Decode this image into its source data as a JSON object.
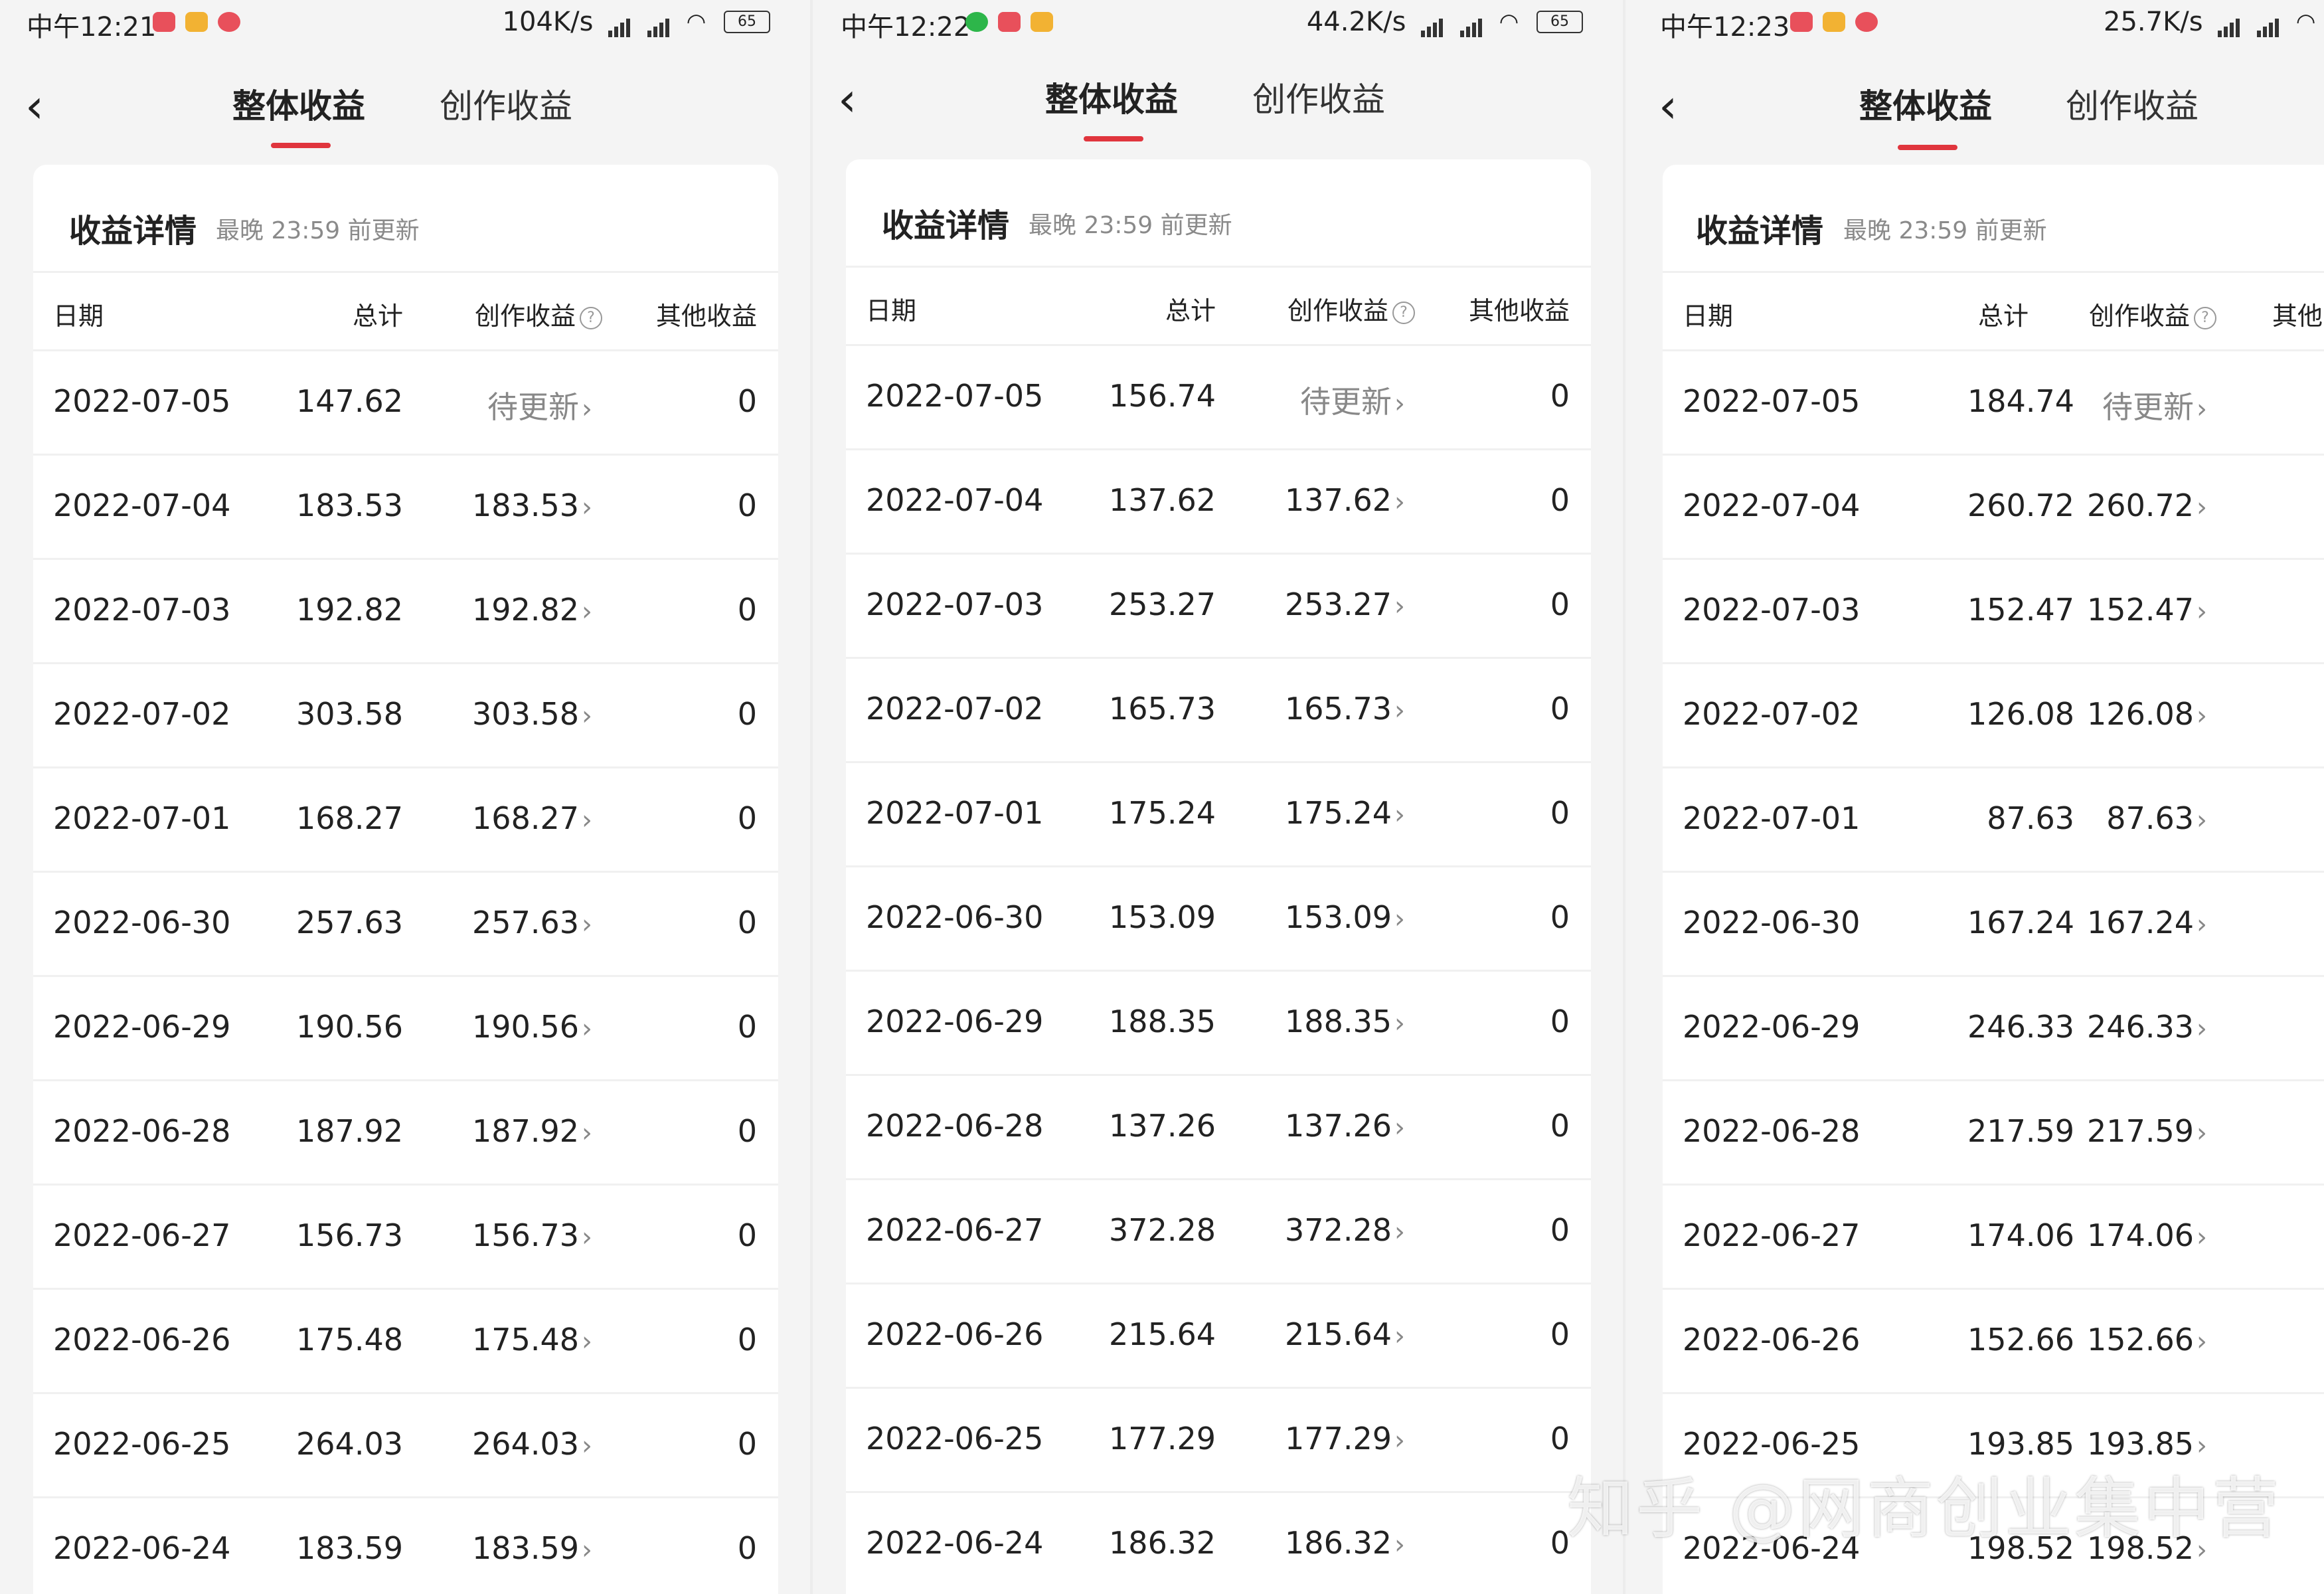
{
  "screens": [
    {
      "status": {
        "time": "中午12:21",
        "net": "104K/s",
        "battery": "65"
      },
      "tabs": [
        "整体收益",
        "创作收益"
      ],
      "card": {
        "title": "收益详情",
        "subtitle": "最晚 23:59 前更新"
      },
      "headers": {
        "date": "日期",
        "total": "总计",
        "creation": "创作收益",
        "other": "其他收益"
      },
      "rows": [
        {
          "date": "2022-07-05",
          "total": "147.62",
          "creation": "待更新",
          "other": "0"
        },
        {
          "date": "2022-07-04",
          "total": "183.53",
          "creation": "183.53",
          "other": "0"
        },
        {
          "date": "2022-07-03",
          "total": "192.82",
          "creation": "192.82",
          "other": "0"
        },
        {
          "date": "2022-07-02",
          "total": "303.58",
          "creation": "303.58",
          "other": "0"
        },
        {
          "date": "2022-07-01",
          "total": "168.27",
          "creation": "168.27",
          "other": "0"
        },
        {
          "date": "2022-06-30",
          "total": "257.63",
          "creation": "257.63",
          "other": "0"
        },
        {
          "date": "2022-06-29",
          "total": "190.56",
          "creation": "190.56",
          "other": "0"
        },
        {
          "date": "2022-06-28",
          "total": "187.92",
          "creation": "187.92",
          "other": "0"
        },
        {
          "date": "2022-06-27",
          "total": "156.73",
          "creation": "156.73",
          "other": "0"
        },
        {
          "date": "2022-06-26",
          "total": "175.48",
          "creation": "175.48",
          "other": "0"
        },
        {
          "date": "2022-06-25",
          "total": "264.03",
          "creation": "264.03",
          "other": "0"
        },
        {
          "date": "2022-06-24",
          "total": "183.59",
          "creation": "183.59",
          "other": "0"
        }
      ]
    },
    {
      "status": {
        "time": "中午12:22",
        "net": "44.2K/s",
        "battery": "65"
      },
      "tabs": [
        "整体收益",
        "创作收益"
      ],
      "card": {
        "title": "收益详情",
        "subtitle": "最晚 23:59 前更新"
      },
      "headers": {
        "date": "日期",
        "total": "总计",
        "creation": "创作收益",
        "other": "其他收益"
      },
      "rows": [
        {
          "date": "2022-07-05",
          "total": "156.74",
          "creation": "待更新",
          "other": "0"
        },
        {
          "date": "2022-07-04",
          "total": "137.62",
          "creation": "137.62",
          "other": "0"
        },
        {
          "date": "2022-07-03",
          "total": "253.27",
          "creation": "253.27",
          "other": "0"
        },
        {
          "date": "2022-07-02",
          "total": "165.73",
          "creation": "165.73",
          "other": "0"
        },
        {
          "date": "2022-07-01",
          "total": "175.24",
          "creation": "175.24",
          "other": "0"
        },
        {
          "date": "2022-06-30",
          "total": "153.09",
          "creation": "153.09",
          "other": "0"
        },
        {
          "date": "2022-06-29",
          "total": "188.35",
          "creation": "188.35",
          "other": "0"
        },
        {
          "date": "2022-06-28",
          "total": "137.26",
          "creation": "137.26",
          "other": "0"
        },
        {
          "date": "2022-06-27",
          "total": "372.28",
          "creation": "372.28",
          "other": "0"
        },
        {
          "date": "2022-06-26",
          "total": "215.64",
          "creation": "215.64",
          "other": "0"
        },
        {
          "date": "2022-06-25",
          "total": "177.29",
          "creation": "177.29",
          "other": "0"
        },
        {
          "date": "2022-06-24",
          "total": "186.32",
          "creation": "186.32",
          "other": "0"
        }
      ]
    },
    {
      "status": {
        "time": "中午12:23",
        "net": "25.7K/s",
        "battery": ""
      },
      "tabs": [
        "整体收益",
        "创作收益"
      ],
      "card": {
        "title": "收益详情",
        "subtitle": "最晚 23:59 前更新"
      },
      "headers": {
        "date": "日期",
        "total": "总计",
        "creation": "创作收益",
        "other": "其他"
      },
      "rows": [
        {
          "date": "2022-07-05",
          "total": "184.74",
          "creation": "待更新",
          "other": ""
        },
        {
          "date": "2022-07-04",
          "total": "260.72",
          "creation": "260.72",
          "other": ""
        },
        {
          "date": "2022-07-03",
          "total": "152.47",
          "creation": "152.47",
          "other": ""
        },
        {
          "date": "2022-07-02",
          "total": "126.08",
          "creation": "126.08",
          "other": ""
        },
        {
          "date": "2022-07-01",
          "total": "87.63",
          "creation": "87.63",
          "other": ""
        },
        {
          "date": "2022-06-30",
          "total": "167.24",
          "creation": "167.24",
          "other": ""
        },
        {
          "date": "2022-06-29",
          "total": "246.33",
          "creation": "246.33",
          "other": ""
        },
        {
          "date": "2022-06-28",
          "total": "217.59",
          "creation": "217.59",
          "other": ""
        },
        {
          "date": "2022-06-27",
          "total": "174.06",
          "creation": "174.06",
          "other": ""
        },
        {
          "date": "2022-06-26",
          "total": "152.66",
          "creation": "152.66",
          "other": ""
        },
        {
          "date": "2022-06-25",
          "total": "193.85",
          "creation": "193.85",
          "other": ""
        },
        {
          "date": "2022-06-24",
          "total": "198.52",
          "creation": "198.52",
          "other": ""
        }
      ]
    }
  ],
  "watermark": "知乎 @网商创业集中营",
  "colors": {
    "accent": "#e0353d",
    "muted": "#8a8a8a"
  }
}
